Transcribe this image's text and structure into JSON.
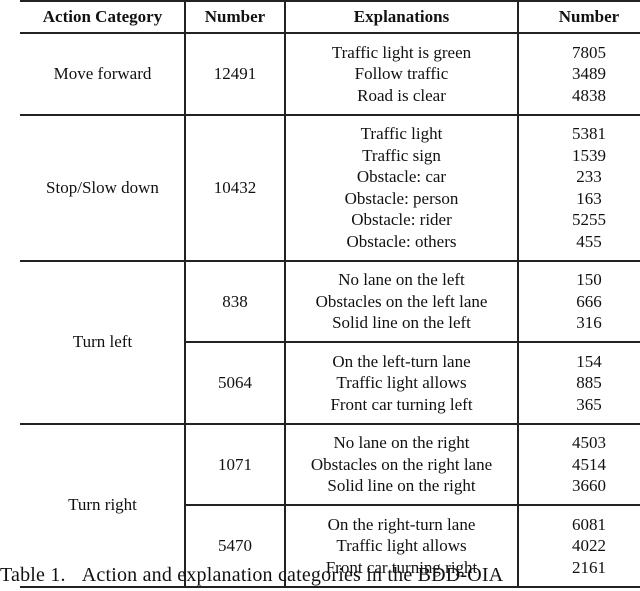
{
  "table": {
    "headers": [
      "Action Category",
      "Number",
      "Explanations",
      "Number"
    ],
    "groups": [
      {
        "action": "Move forward",
        "subgroups": [
          {
            "number": "12491",
            "explanations": [
              "Traffic light is green",
              "Follow traffic",
              "Road is clear"
            ],
            "counts": [
              "7805",
              "3489",
              "4838"
            ]
          }
        ]
      },
      {
        "action": "Stop/Slow down",
        "subgroups": [
          {
            "number": "10432",
            "explanations": [
              "Traffic light",
              "Traffic sign",
              "Obstacle: car",
              "Obstacle: person",
              "Obstacle: rider",
              "Obstacle: others"
            ],
            "counts": [
              "5381",
              "1539",
              "233",
              "163",
              "5255",
              "455"
            ]
          }
        ]
      },
      {
        "action": "Turn left",
        "subgroups": [
          {
            "number": "838",
            "explanations": [
              "No lane on the left",
              "Obstacles on the left lane",
              "Solid line on the left"
            ],
            "counts": [
              "150",
              "666",
              "316"
            ]
          },
          {
            "number": "5064",
            "explanations": [
              "On the left-turn lane",
              "Traffic light allows",
              "Front car turning left"
            ],
            "counts": [
              "154",
              "885",
              "365"
            ]
          }
        ]
      },
      {
        "action": "Turn right",
        "subgroups": [
          {
            "number": "1071",
            "explanations": [
              "No lane on the right",
              "Obstacles on the right lane",
              "Solid line on the right"
            ],
            "counts": [
              "4503",
              "4514",
              "3660"
            ]
          },
          {
            "number": "5470",
            "explanations": [
              "On the right-turn lane",
              "Traffic light allows",
              "Front car turning right"
            ],
            "counts": [
              "6081",
              "4022",
              "2161"
            ]
          }
        ]
      }
    ]
  },
  "caption": {
    "label": "Table 1.",
    "text": "Action and explanation categories in the BDD-OIA"
  }
}
